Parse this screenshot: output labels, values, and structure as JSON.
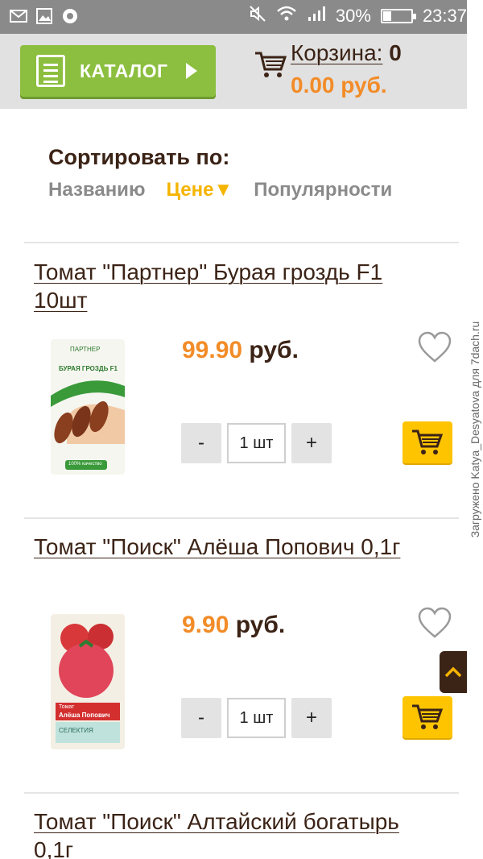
{
  "status_bar": {
    "battery": "30%",
    "battery_level": 0.3,
    "time": "23:37",
    "icons": [
      "mail-icon",
      "image-icon",
      "chrome-icon",
      "mute-icon",
      "wifi-icon",
      "signal-icon",
      "battery-icon"
    ]
  },
  "header": {
    "catalog_label": "КАТАЛОГ",
    "cart_label": "Корзина:",
    "cart_count": "0",
    "cart_total": "0.00 руб."
  },
  "sort": {
    "title": "Сортировать по:",
    "options": [
      "Названию",
      "Цене▼",
      "Популярности"
    ],
    "active": "Цене▼"
  },
  "products": [
    {
      "title": "Томат \"Партнер\" Бурая гроздь F1 10шт",
      "price": "99.90",
      "currency": "руб.",
      "qty": "1 шт",
      "minus": "-",
      "plus": "+",
      "image_brand": "ПАРТНЕР",
      "image_name": "БУРАЯ ГРОЗДЬ F1",
      "image_badge": "100% качество"
    },
    {
      "title": "Томат \"Поиск\" Алёша Попович 0,1г",
      "price": "9.90",
      "currency": "руб.",
      "qty": "1 шт",
      "minus": "-",
      "plus": "+",
      "image_brand": "Томат",
      "image_name": "Алёша Попович",
      "image_badge": "СЕЛЕКТИЯ"
    },
    {
      "title": "Томат \"Поиск\" Алтайский богатырь 0,1г"
    }
  ],
  "watermark": "Загружено Katya_Desyatova для 7dach.ru",
  "colors": {
    "accent_orange": "#f28c28",
    "catalog_green": "#8cbf3f",
    "cart_yellow": "#ffc400",
    "text_brown": "#3b2316",
    "sort_active": "#f5b400"
  }
}
